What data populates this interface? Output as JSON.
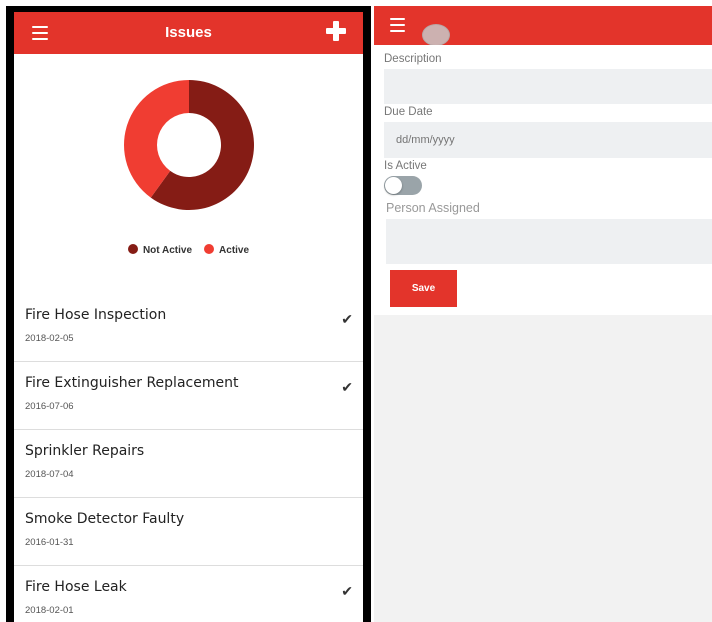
{
  "left": {
    "header": {
      "title": "Issues",
      "menu_icon": "hamburger-icon",
      "add_icon": "plus-icon"
    },
    "chart_data": {
      "type": "pie",
      "variant": "donut",
      "slices": [
        {
          "label": "Not Active",
          "value": 60,
          "color": "#851c15"
        },
        {
          "label": "Active",
          "value": 40,
          "color": "#f03d32"
        }
      ],
      "legend_placement": "bottom"
    },
    "legend": [
      {
        "label": "Not Active",
        "color": "#851c15"
      },
      {
        "label": "Active",
        "color": "#f03d32"
      }
    ],
    "issues": [
      {
        "name": "Fire Hose Inspection",
        "date": "2018-02-05",
        "done": true
      },
      {
        "name": "Fire Extinguisher Replacement",
        "date": "2016-07-06",
        "done": true
      },
      {
        "name": "Sprinkler Repairs",
        "date": "2018-07-04",
        "done": false
      },
      {
        "name": "Smoke Detector Faulty",
        "date": "2016-01-31",
        "done": false
      },
      {
        "name": "Fire Hose Leak",
        "date": "2018-02-01",
        "done": true
      }
    ],
    "check_glyph": "✔"
  },
  "right": {
    "header": {
      "menu_icon": "hamburger-icon"
    },
    "form": {
      "description_label": "Description",
      "description_value": "",
      "due_date_label": "Due Date",
      "due_date_placeholder": "dd/mm/yyyy",
      "is_active_label": "Is Active",
      "is_active_value": false,
      "person_label": "Person Assigned",
      "person_value": "",
      "save_label": "Save"
    }
  },
  "colors": {
    "accent": "#e3342b",
    "field_bg": "#eef0f2",
    "panel_border": "#000000"
  }
}
